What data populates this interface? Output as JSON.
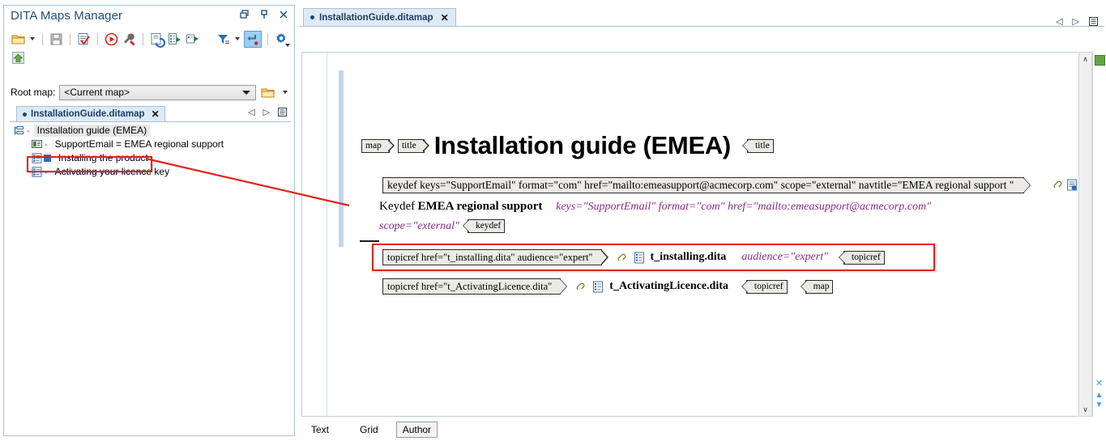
{
  "panel": {
    "title": "DITA Maps Manager",
    "window_buttons": [
      {
        "name": "restore-icon",
        "label": "restore"
      },
      {
        "name": "pin-icon",
        "label": "pin"
      },
      {
        "name": "close-icon",
        "label": "close"
      }
    ],
    "toolbar": {
      "row1": [
        {
          "name": "open-folder-icon",
          "label": "Open"
        },
        {
          "name": "open-dropdown-caret-icon",
          "label": ""
        },
        {
          "name": "save-icon",
          "label": "Save"
        },
        {
          "name": "validate-icon",
          "label": "Validate"
        },
        {
          "name": "transform-run-icon",
          "label": "Apply transformation scenario"
        },
        {
          "name": "configure-transform-icon",
          "label": "Configure transformation scenario"
        },
        {
          "name": "refresh-references-icon",
          "label": "Refresh references"
        },
        {
          "name": "expand-all-icon",
          "label": "Expand all"
        },
        {
          "name": "collapse-all-icon",
          "label": "Collapse all"
        },
        {
          "name": "filter-icon",
          "label": "Filter"
        },
        {
          "name": "filter-dropdown-caret-icon",
          "label": ""
        },
        {
          "name": "link-with-editor-icon",
          "label": "Link with editor"
        },
        {
          "name": "settings-gear-icon",
          "label": "Options"
        }
      ],
      "row2": [
        {
          "name": "go-up-home-icon",
          "label": "Go up"
        }
      ]
    },
    "root_map": {
      "label": "Root map:",
      "value": "<Current map>",
      "browse_icon": "browse-folder-icon",
      "browse_caret_icon": "browse-dropdown-caret-icon"
    },
    "tab": {
      "label": "InstallationGuide.ditamap",
      "close_label": "✕",
      "nav": [
        {
          "name": "previous-icon",
          "glyph": "◁"
        },
        {
          "name": "next-icon",
          "glyph": "▷"
        },
        {
          "name": "tab-list-icon",
          "glyph": "☰"
        }
      ]
    },
    "tree": [
      {
        "label": "Installation guide (EMEA)",
        "icon": "map-root-icon",
        "marker": "-",
        "indent": 0,
        "selected": true
      },
      {
        "label": "SupportEmail = EMEA regional support",
        "icon": "keydef-icon",
        "marker": "-",
        "indent": 1,
        "selected": false
      },
      {
        "label": "Installing the product",
        "icon": "topicref-icon",
        "marker": "■",
        "indent": 1,
        "selected": false
      },
      {
        "label": "Activating your licence key",
        "icon": "topicref-icon",
        "marker": "-",
        "indent": 1,
        "selected": false
      }
    ]
  },
  "editor": {
    "tab": {
      "label": "InstallationGuide.ditamap",
      "close_label": "✕"
    },
    "tab_nav": [
      {
        "name": "previous-editor-icon",
        "glyph": "◁"
      },
      {
        "name": "next-editor-icon",
        "glyph": "▷"
      },
      {
        "name": "editor-list-icon",
        "glyph": "☰"
      }
    ],
    "doc": {
      "title_tags": [
        {
          "name": "map-start-tag",
          "label": "map"
        },
        {
          "name": "title-start-tag",
          "label": "title"
        }
      ],
      "title": "Installation guide (EMEA)",
      "title_end_tag": "title",
      "keydef_attr_line": "keydef keys=\"SupportEmail\" format=\"com\" href=\"mailto:emeasupport@acmecorp.com\" scope=\"external\" navtitle=\"EMEA regional support \"",
      "keydef_label": "Keydef",
      "keydef_name": "EMEA regional support",
      "keydef_attrs_line1": "keys=\"SupportEmail\" format=\"com\" href=\"mailto:emeasupport@acmecorp.com\"",
      "keydef_attrs_line2": "scope=\"external\"",
      "keydef_end_tag": "keydef",
      "rows": [
        {
          "attr_tag": "topicref href=\"t_installing.dita\" audience=\"expert\"",
          "file": "t_installing.dita",
          "attrs": "audience=\"expert\"",
          "end_tags": [
            "topicref"
          ],
          "highlighted": true
        },
        {
          "attr_tag": "topicref href=\"t_ActivatingLicence.dita\"",
          "file": "t_ActivatingLicence.dita",
          "attrs": "",
          "end_tags": [
            "topicref",
            "map"
          ],
          "highlighted": false
        }
      ]
    },
    "scroll": {
      "up_glyph": "∧",
      "down_glyph": "∨",
      "marker_color": "#62a744",
      "extra_icons": [
        {
          "name": "close-markers-icon",
          "glyph": "✕"
        },
        {
          "name": "previous-marker-icon",
          "glyph": "▲"
        },
        {
          "name": "next-marker-icon",
          "glyph": "▼"
        }
      ]
    },
    "bottom_tabs": [
      {
        "label": "Text",
        "active": false
      },
      {
        "label": "Grid",
        "active": false
      },
      {
        "label": "Author",
        "active": true
      }
    ]
  },
  "annotation": {
    "callout_color": "#e32119",
    "arrow_name": "red-callout-arrow"
  }
}
